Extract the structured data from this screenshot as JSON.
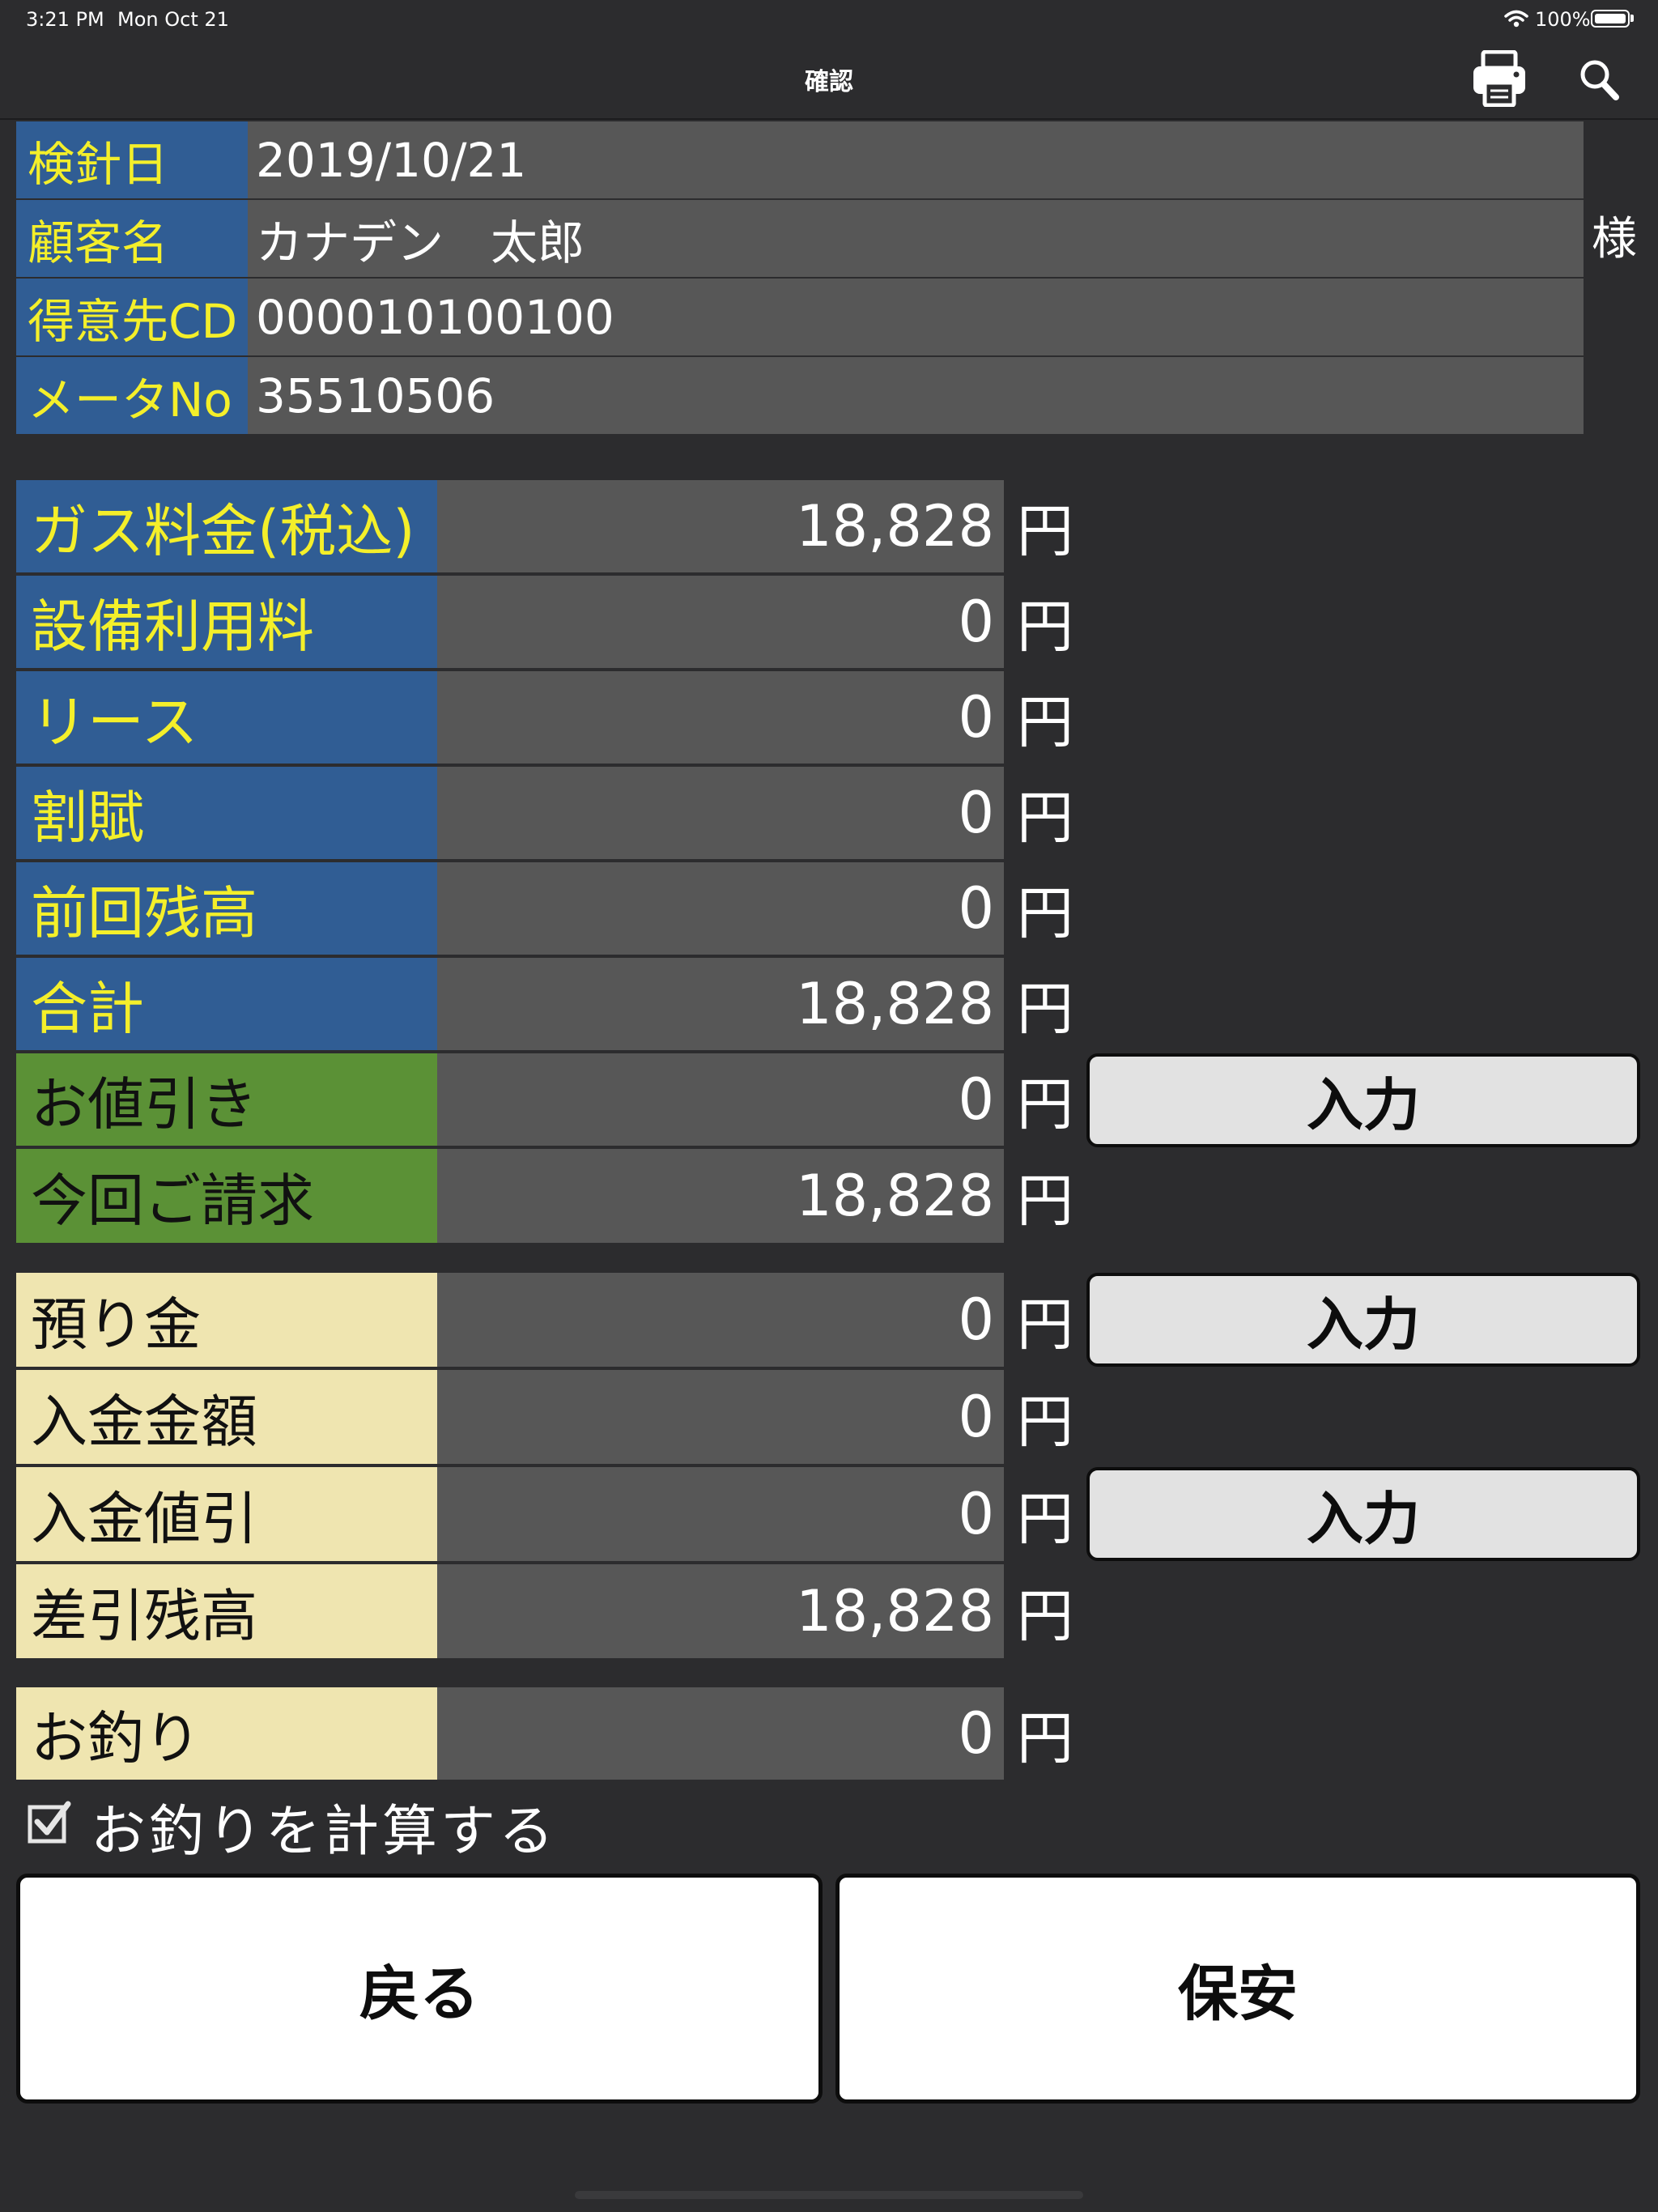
{
  "status_bar": {
    "time": "3:21 PM",
    "date": "Mon Oct 21",
    "battery": "100%",
    "battery_level": 1.0,
    "icons": [
      "wifi-icon",
      "battery-icon"
    ]
  },
  "nav": {
    "title": "確認",
    "actions": [
      "printer-icon",
      "search-icon"
    ]
  },
  "info": {
    "rows": [
      {
        "label": "検針日",
        "value": "2019/10/21"
      },
      {
        "label": "顧客名",
        "value": "カナデン　太郎"
      },
      {
        "label": "得意先CD",
        "value": "000010100100"
      },
      {
        "label": "メータNo",
        "value": "35510506"
      }
    ],
    "honorific": "様"
  },
  "currency": "円",
  "billing": [
    {
      "label": "ガス料金(税込)",
      "value": "18,828"
    },
    {
      "label": "設備利用料",
      "value": "0"
    },
    {
      "label": "リース",
      "value": "0"
    },
    {
      "label": "割賦",
      "value": "0"
    },
    {
      "label": "前回残高",
      "value": "0"
    },
    {
      "label": "合計",
      "value": "18,828"
    },
    {
      "label": "お値引き",
      "value": "0",
      "button": "入力"
    },
    {
      "label": "今回ご請求",
      "value": "18,828"
    }
  ],
  "payment": [
    {
      "label": "預り金",
      "value": "0",
      "button": "入力"
    },
    {
      "label": "入金金額",
      "value": "0"
    },
    {
      "label": "入金値引",
      "value": "0",
      "button": "入力"
    },
    {
      "label": "差引残高",
      "value": "18,828"
    }
  ],
  "change": {
    "label": "お釣り",
    "value": "0"
  },
  "calc_change": {
    "label": "お釣りを計算する",
    "checked": true
  },
  "footer": {
    "back": "戻る",
    "safety": "保安"
  },
  "colors": {
    "background": "#2c2c2e",
    "label_blue": "#305d94",
    "label_text_yellow": "#f4ef2a",
    "label_green": "#5b9136",
    "label_cream": "#efe5b0",
    "value_gray": "#575757",
    "button_gray": "#e2e2e2"
  }
}
